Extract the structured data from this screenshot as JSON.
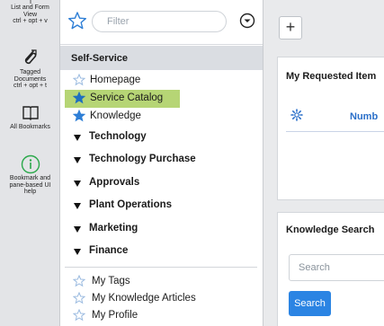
{
  "rail": {
    "items": [
      {
        "label_lines": [
          "List and Form",
          "View",
          "ctrl + opt + v"
        ],
        "icon": "list-form-icon"
      },
      {
        "label_lines": [
          "Tagged",
          "Documents",
          "ctrl + opt + t"
        ],
        "icon": "paperclip-icon"
      },
      {
        "label_lines": [
          "All Bookmarks"
        ],
        "icon": "book-icon"
      },
      {
        "label_lines": [
          "Bookmark and",
          "pane-based UI",
          "help"
        ],
        "icon": "info-icon"
      }
    ]
  },
  "nav": {
    "filter": {
      "placeholder": "Filter",
      "value": ""
    },
    "section_title": "Self-Service",
    "items": [
      {
        "label": "Homepage",
        "favorite": false
      },
      {
        "label": "Service Catalog",
        "favorite": true,
        "active": true
      },
      {
        "label": "Knowledge",
        "favorite": true
      }
    ],
    "groups": [
      "Technology",
      "Technology Purchase",
      "Approvals",
      "Plant Operations",
      "Marketing",
      "Finance"
    ],
    "bottom_items": [
      {
        "label": "My Tags"
      },
      {
        "label": "My Knowledge Articles"
      },
      {
        "label": "My Profile"
      }
    ]
  },
  "main": {
    "add_label": "+",
    "requested": {
      "title": "My Requested Item",
      "number_header": "Numb"
    },
    "knowledge": {
      "title": "Knowledge Search",
      "search_placeholder": "Search",
      "search_button": "Search"
    }
  },
  "colors": {
    "accent": "#2b84e3",
    "active_bg": "#b6d575",
    "star_fill": "#2f7fd6",
    "section_bg": "#dadde2"
  }
}
